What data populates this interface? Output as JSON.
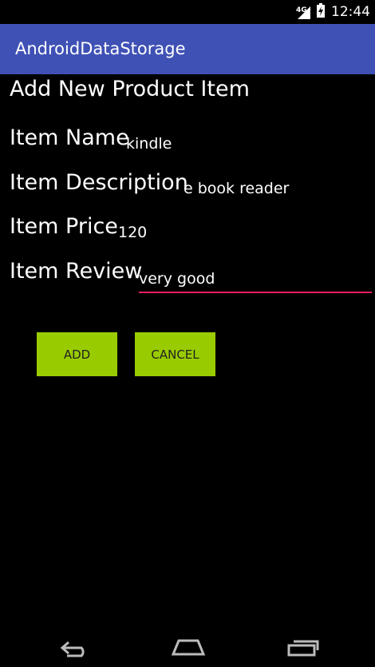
{
  "status_bar": {
    "network": "4G",
    "time": "12:44",
    "icons": [
      "signal-icon",
      "battery-icon"
    ]
  },
  "app_bar": {
    "title": "AndroidDataStorage"
  },
  "form": {
    "heading": "Add New Product Item",
    "item_name": {
      "label": "Item Name",
      "value": "kindle"
    },
    "item_description": {
      "label": "Item Description",
      "value": "e book reader"
    },
    "item_price": {
      "label": "Item Price",
      "value": "120"
    },
    "item_review": {
      "label": "Item Review",
      "value": "very good"
    }
  },
  "buttons": {
    "add_label": "ADD",
    "cancel_label": "CANCEL"
  },
  "nav_bar": {
    "icons": [
      "back-icon",
      "home-icon",
      "recents-icon"
    ]
  },
  "colors": {
    "app_bar": "#3f51b5",
    "button": "#99cc00",
    "input_underline": "#e91e63"
  }
}
